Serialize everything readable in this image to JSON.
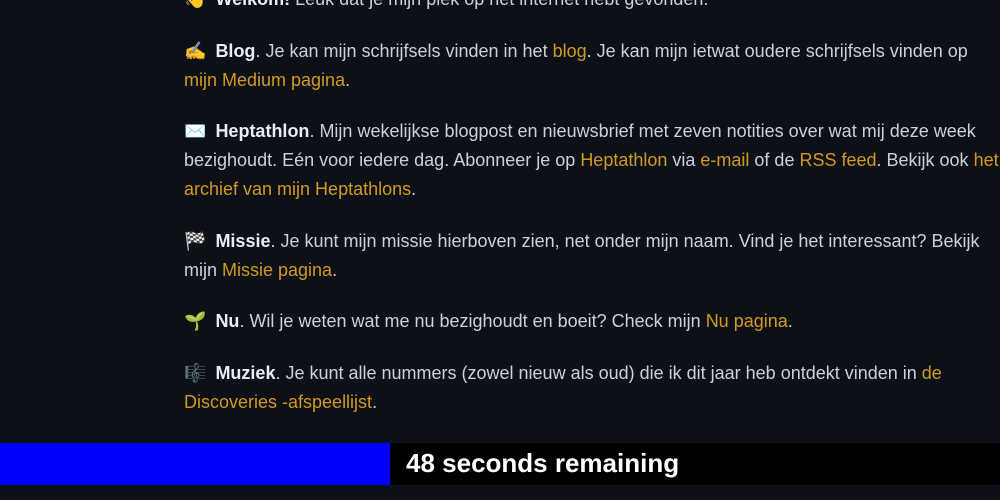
{
  "sections": {
    "welkom": {
      "emoji": "👋",
      "title": "Welkom!",
      "text": " Leuk dat je mijn plek op het internet hebt gevonden."
    },
    "blog": {
      "emoji": "✍️",
      "title": "Blog",
      "text1": ". Je kan mijn schrijfsels vinden in het ",
      "link1": "blog",
      "text2": ". Je kan mijn ietwat oudere schrijfsels vinden op ",
      "link2": "mijn Medium pagina",
      "text3": "."
    },
    "heptathlon": {
      "emoji": "✉️",
      "title": "Heptathlon",
      "text1": ". Mijn wekelijkse blogpost en nieuwsbrief met zeven notities over wat mij deze week bezighoudt. Eén voor iedere dag. Abonneer je op ",
      "link1": "Heptathlon",
      "text2": " via ",
      "link2": "e-mail",
      "text3": " of de ",
      "link3": "RSS feed",
      "text4": ". Bekijk ook ",
      "link4": "het archief van mijn Heptathlons",
      "text5": "."
    },
    "missie": {
      "emoji": "🏁",
      "title": "Missie",
      "text1": ". Je kunt mijn missie hierboven zien, net onder mijn naam. Vind je het interessant? Bekijk mijn ",
      "link1": "Missie pagina",
      "text2": "."
    },
    "nu": {
      "emoji": "🌱",
      "title": "Nu",
      "text1": ". Wil je weten wat me nu bezighoudt en boeit? Check mijn ",
      "link1": "Nu pagina",
      "text2": "."
    },
    "muziek": {
      "emoji": "🎼",
      "title": "Muziek",
      "text1": ". Je kunt alle nummers (zowel nieuw als oud) die ik dit jaar heb ontdekt vinden in ",
      "link1": "de Discoveries -afspeellijst",
      "text2": "."
    }
  },
  "footer": {
    "countdown": "48 seconds remaining"
  }
}
